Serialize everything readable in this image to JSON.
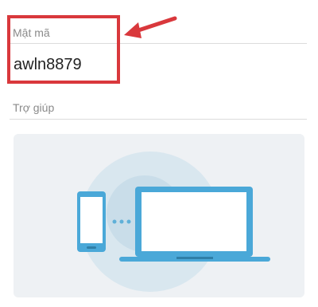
{
  "password_section": {
    "label": "Mật mã",
    "value": "awln8879"
  },
  "help_section": {
    "label": "Trợ giúp"
  },
  "colors": {
    "highlight": "#d9383c",
    "device_blue": "#4aa8d8",
    "circle": "#d9e7ef"
  },
  "illustration": {
    "icons": [
      "phone-icon",
      "laptop-icon"
    ]
  }
}
